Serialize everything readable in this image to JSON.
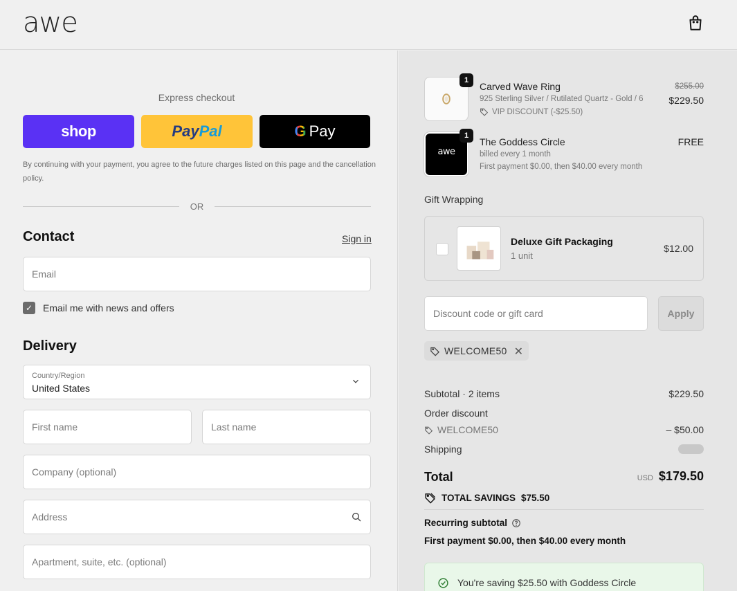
{
  "header": {
    "logo": "awe",
    "bag_icon": "shopping-bag-icon"
  },
  "express": {
    "title": "Express checkout",
    "shop_label": "shop",
    "paypal_label_1": "Pay",
    "paypal_label_2": "Pal",
    "gpay_g": "G",
    "gpay_label": "Pay",
    "legal": "By continuing with your payment, you agree to the future charges listed on this page and the cancellation policy.",
    "or": "OR"
  },
  "contact": {
    "title": "Contact",
    "sign_in": "Sign in",
    "email_placeholder": "Email",
    "newsletter_label": "Email me with news and offers",
    "newsletter_checked": true
  },
  "delivery": {
    "title": "Delivery",
    "country_label": "Country/Region",
    "country_value": "United States",
    "first_name_placeholder": "First name",
    "last_name_placeholder": "Last name",
    "company_placeholder": "Company (optional)",
    "address_placeholder": "Address",
    "apartment_placeholder": "Apartment, suite, etc. (optional)"
  },
  "cart": {
    "items": [
      {
        "qty": "1",
        "name": "Carved Wave Ring",
        "variant": "925 Sterling Silver / Rutilated Quartz - Gold / 6",
        "discount": "VIP DISCOUNT (-$25.50)",
        "original_price": "$255.00",
        "price": "$229.50"
      },
      {
        "qty": "1",
        "name": "The Goddess Circle",
        "billing": "billed every 1 month",
        "payment": "First payment $0.00, then $40.00 every month",
        "price": "FREE",
        "thumb_logo": "awe"
      }
    ],
    "gift_wrapping": {
      "title": "Gift Wrapping",
      "name": "Deluxe Gift Packaging",
      "unit": "1 unit",
      "price": "$12.00"
    },
    "discount": {
      "placeholder": "Discount code or gift card",
      "apply": "Apply",
      "applied_code": "WELCOME50"
    },
    "summary": {
      "subtotal_label": "Subtotal · 2 items",
      "subtotal_value": "$229.50",
      "order_discount_label": "Order discount",
      "discount_code": "WELCOME50",
      "discount_value": "– $50.00",
      "shipping_label": "Shipping",
      "total_label": "Total",
      "currency": "USD",
      "total_value": "$179.50",
      "savings_label": "TOTAL SAVINGS",
      "savings_value": "$75.50",
      "recurring_label": "Recurring subtotal",
      "recurring_value": "First payment $0.00, then $40.00 every month"
    },
    "banner": "You're saving $25.50 with Goddess Circle"
  },
  "colors": {
    "shop": "#5a31f4",
    "paypal": "#ffc439",
    "gpay": "#000000",
    "banner_bg": "#e9f7e9"
  }
}
